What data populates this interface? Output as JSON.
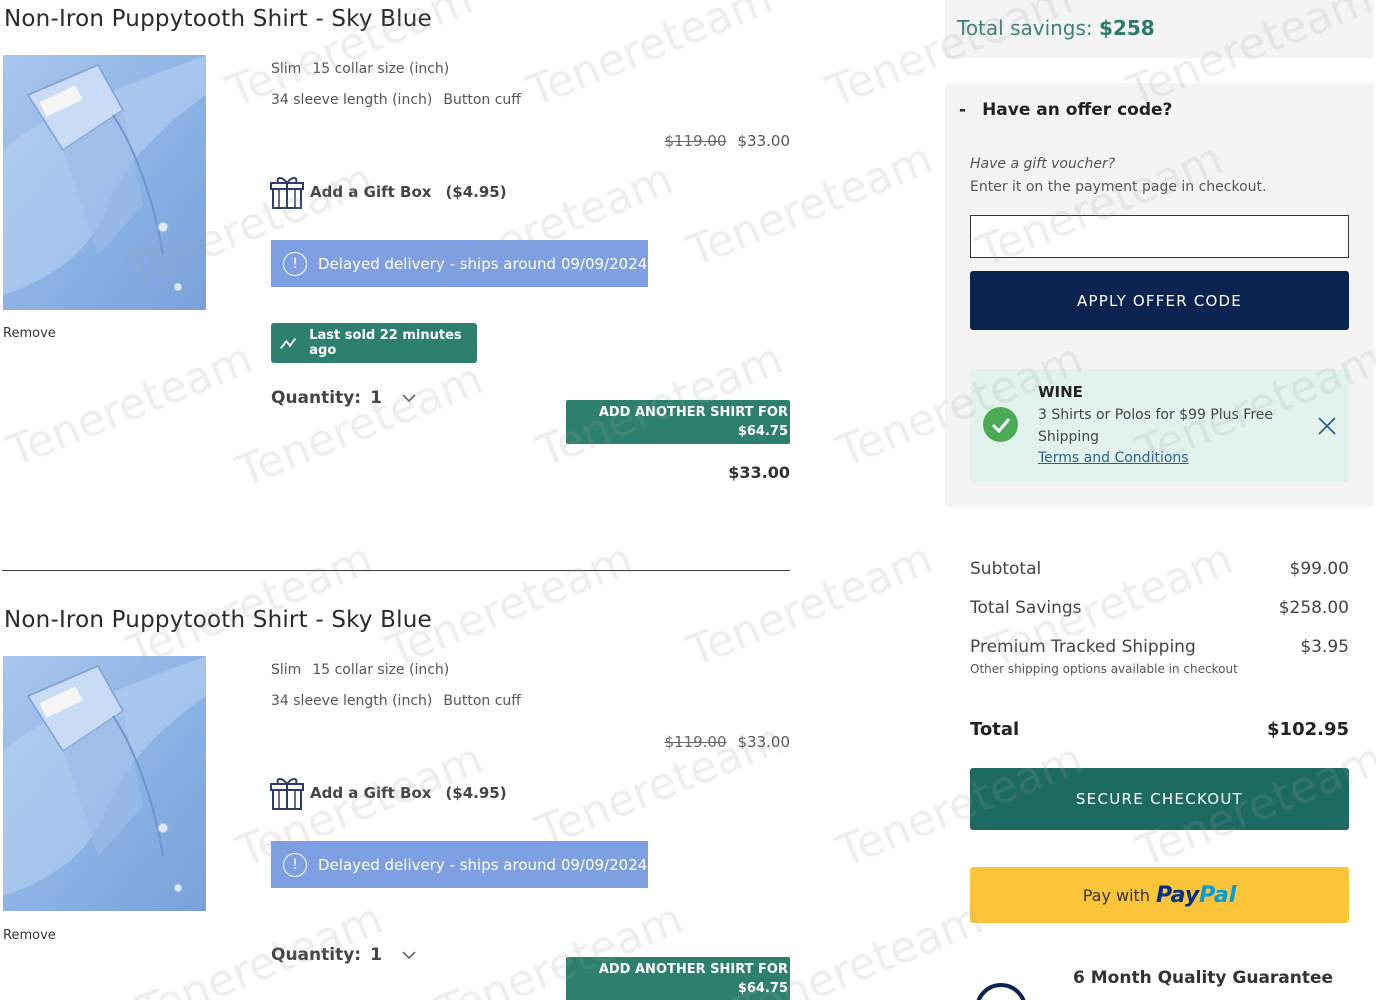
{
  "cart": {
    "items": [
      {
        "title": "Non-Iron Puppytooth Shirt - Sky Blue",
        "fit": "Slim",
        "collar": "15 collar size (inch)",
        "sleeve": "34 sleeve length (inch)",
        "cuff": "Button cuff",
        "original_price": "$119.00",
        "price": "$33.00",
        "gift_label": "Add a Gift Box",
        "gift_price": "($4.95)",
        "delivery_notice": "Delayed delivery - ships around 09/09/2024",
        "last_sold": "Last sold 22 minutes ago",
        "quantity_label": "Quantity:",
        "quantity_value": "1",
        "add_another_line1": "ADD ANOTHER SHIRT FOR",
        "add_another_line2": "$64.75",
        "line_total": "$33.00",
        "remove_label": "Remove"
      },
      {
        "title": "Non-Iron Puppytooth Shirt - Sky Blue",
        "fit": "Slim",
        "collar": "15 collar size (inch)",
        "sleeve": "34 sleeve length (inch)",
        "cuff": "Button cuff",
        "original_price": "$119.00",
        "price": "$33.00",
        "gift_label": "Add a Gift Box",
        "gift_price": "($4.95)",
        "delivery_notice": "Delayed delivery - ships around 09/09/2024",
        "quantity_label": "Quantity:",
        "quantity_value": "1",
        "add_another_line1": "ADD ANOTHER SHIRT FOR",
        "add_another_line2": "$64.75",
        "remove_label": "Remove"
      }
    ]
  },
  "summary": {
    "savings_label": "Total savings:",
    "savings_amount": "$258",
    "offer_toggle": "-",
    "offer_heading": "Have an offer code?",
    "voucher_question": "Have a gift voucher?",
    "voucher_hint": "Enter it on the payment page in checkout.",
    "offer_input_value": "",
    "apply_button": "APPLY OFFER CODE",
    "promo": {
      "code": "WINE",
      "description": "3 Shirts or Polos for $99 Plus Free Shipping",
      "terms_link": "Terms and Conditions"
    },
    "subtotal_label": "Subtotal",
    "subtotal_value": "$99.00",
    "total_savings_label": "Total Savings",
    "total_savings_value": "$258.00",
    "shipping_label": "Premium Tracked Shipping",
    "shipping_value": "$3.95",
    "shipping_note": "Other shipping options available in checkout",
    "total_label": "Total",
    "total_value": "$102.95",
    "checkout_button": "SECURE CHECKOUT",
    "paypal_prefix": "Pay with",
    "paypal_brand_a": "Pay",
    "paypal_brand_b": "Pal",
    "guarantee_title": "6 Month Quality Guarantee"
  },
  "watermark": {
    "text": "Tenereteam"
  },
  "colors": {
    "teal": "#2d7f6e",
    "navy": "#0b2350",
    "delay_blue": "#7f9fe3",
    "paypal_yellow": "#fcc439",
    "promo_bg": "#e2f3ee",
    "check_green": "#4caa55"
  }
}
